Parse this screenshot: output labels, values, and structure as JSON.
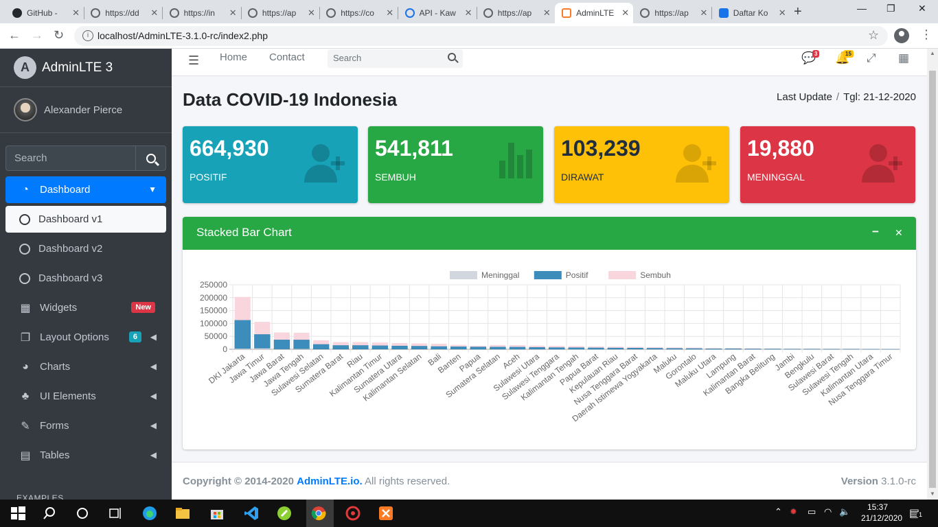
{
  "browser": {
    "tabs": [
      {
        "title": "GitHub -",
        "icon": "github-icon"
      },
      {
        "title": "https://dd",
        "icon": "globe-icon"
      },
      {
        "title": "https://in",
        "icon": "globe-icon"
      },
      {
        "title": "https://ap",
        "icon": "globe-icon"
      },
      {
        "title": "https://co",
        "icon": "globe-icon"
      },
      {
        "title": "API - Kaw",
        "icon": "api-icon"
      },
      {
        "title": "https://ap",
        "icon": "globe-icon"
      },
      {
        "title": "AdminLTE",
        "icon": "xampp-icon",
        "active": true
      },
      {
        "title": "https://ap",
        "icon": "globe-icon"
      },
      {
        "title": "Daftar Ko",
        "icon": "list-icon"
      }
    ],
    "url": "localhost/AdminLTE-3.1.0-rc/index2.php"
  },
  "sidebar": {
    "brand": "AdminLTE 3",
    "user": "Alexander Pierce",
    "search_placeholder": "Search",
    "items": [
      {
        "label": "Dashboard"
      },
      {
        "label": "Dashboard v1"
      },
      {
        "label": "Dashboard v2"
      },
      {
        "label": "Dashboard v3"
      },
      {
        "label": "Widgets",
        "badge": "New"
      },
      {
        "label": "Layout Options",
        "badge": "6"
      },
      {
        "label": "Charts"
      },
      {
        "label": "UI Elements"
      },
      {
        "label": "Forms"
      },
      {
        "label": "Tables"
      }
    ],
    "section": "EXAMPLES"
  },
  "header": {
    "home": "Home",
    "contact": "Contact",
    "search_placeholder": "Search",
    "messages_count": "3",
    "notifications_count": "15"
  },
  "page": {
    "title": "Data COVID-19 Indonesia",
    "breadcrumb_1": "Last Update",
    "breadcrumb_2": "Tgl: 21-12-2020"
  },
  "stats": [
    {
      "value": "664,930",
      "label": "POSITIF"
    },
    {
      "value": "541,811",
      "label": "SEMBUH"
    },
    {
      "value": "103,239",
      "label": "DIRAWAT"
    },
    {
      "value": "19,880",
      "label": "MENINGGAL"
    }
  ],
  "card": {
    "title": "Stacked Bar Chart",
    "minimize": "−",
    "close": "✕"
  },
  "chart_data": {
    "type": "bar",
    "stacked": true,
    "categories": [
      "DKI Jakarta",
      "Jawa Timur",
      "Jawa Barat",
      "Jawa Tengah",
      "Sulawesi Selatan",
      "Sumatera Barat",
      "Riau",
      "Kalimantan Timur",
      "Sumatera Utara",
      "Kalimantan Selatan",
      "Bali",
      "Banten",
      "Papua",
      "Sumatera Selatan",
      "Aceh",
      "Sulawesi Utara",
      "Sulawesi Tenggara",
      "Kalimantan Tengah",
      "Papua Barat",
      "Kepulauan Riau",
      "Nusa Tenggara Barat",
      "Daerah Istimewa Yogyakarta",
      "Maluku",
      "Gorontalo",
      "Maluku Utara",
      "Lampung",
      "Kalimantan Barat",
      "Bangka Belitung",
      "Jambi",
      "Bengkulu",
      "Sulawesi Barat",
      "Sulawesi Tengah",
      "Kalimantan Utara",
      "Nusa Tenggara Timur"
    ],
    "series": [
      {
        "name": "Meninggal",
        "color": "#d2d6de",
        "values": [
          3000,
          4200,
          1100,
          2000,
          600,
          450,
          500,
          550,
          550,
          750,
          350,
          500,
          150,
          400,
          300,
          450,
          150,
          250,
          80,
          180,
          350,
          220,
          80,
          80,
          60,
          250,
          80,
          40,
          40,
          100,
          30,
          100,
          40,
          50
        ]
      },
      {
        "name": "Positif",
        "color": "#3c8dbc",
        "values": [
          110000,
          54000,
          36000,
          35000,
          19000,
          15000,
          15000,
          14000,
          13000,
          12000,
          11000,
          10000,
          9500,
          9000,
          8800,
          7500,
          7000,
          6500,
          6000,
          5500,
          5000,
          4500,
          4000,
          3500,
          2500,
          2500,
          2000,
          1800,
          1200,
          1100,
          1000,
          900,
          800,
          700
        ]
      },
      {
        "name": "Sembuh",
        "color": "#f9d6de",
        "values": [
          90000,
          48000,
          28000,
          27000,
          15500,
          12500,
          12500,
          11500,
          10500,
          10000,
          10000,
          6500,
          4000,
          7000,
          7000,
          6000,
          6000,
          5500,
          5000,
          4500,
          4000,
          3500,
          3000,
          3000,
          2200,
          2000,
          1700,
          1500,
          1000,
          900,
          800,
          700,
          600,
          500
        ]
      }
    ],
    "yticks": [
      0,
      50000,
      100000,
      150000,
      200000,
      250000
    ],
    "ylim": [
      0,
      250000
    ],
    "legend_position": "top",
    "grid": true
  },
  "footer": {
    "copyright": "Copyright © 2014-2020",
    "brand_link": "AdminLTE.io.",
    "rights": "All rights reserved.",
    "version_label": "Version",
    "version": "3.1.0-rc"
  },
  "taskbar": {
    "time": "15:37",
    "date": "21/12/2020",
    "notifications": "1"
  }
}
